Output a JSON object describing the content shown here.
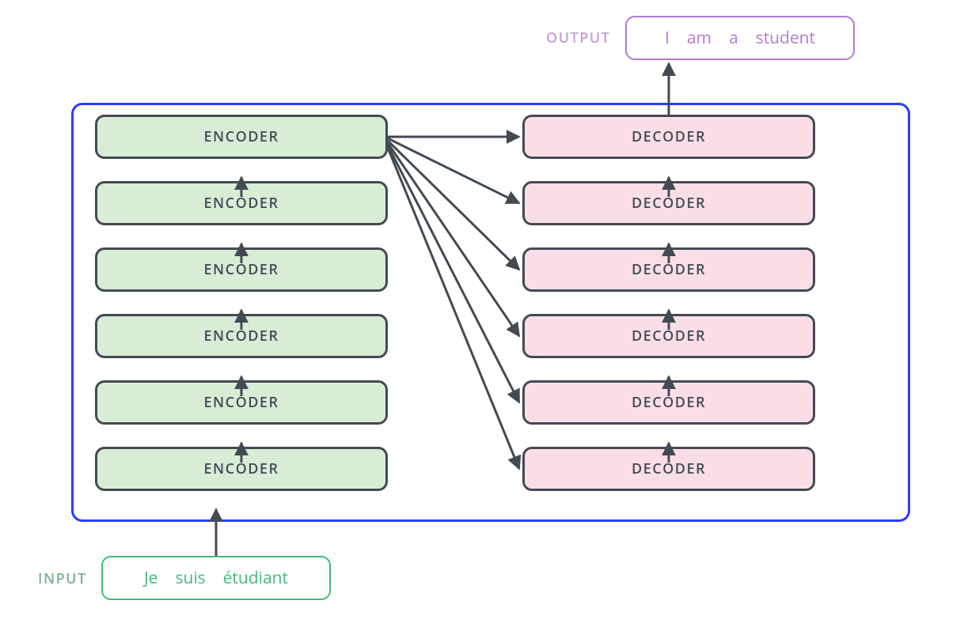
{
  "encoders": [
    "ENCODER",
    "ENCODER",
    "ENCODER",
    "ENCODER",
    "ENCODER",
    "ENCODER"
  ],
  "decoders": [
    "DECODER",
    "DECODER",
    "DECODER",
    "DECODER",
    "DECODER",
    "DECODER"
  ],
  "input": {
    "label": "INPUT",
    "tokens": [
      "Je",
      "suis",
      "étudiant"
    ]
  },
  "output": {
    "label": "OUTPUT",
    "tokens": [
      "I",
      "am",
      "a",
      "student"
    ]
  },
  "colors": {
    "container_border": "#2a3dff",
    "block_border": "#444a52",
    "encoder_fill": "#d9ecd6",
    "decoder_fill": "#f9dee8",
    "input_color": "#3fbb7a",
    "output_color": "#b37ad1",
    "arrow": "#444a52"
  }
}
